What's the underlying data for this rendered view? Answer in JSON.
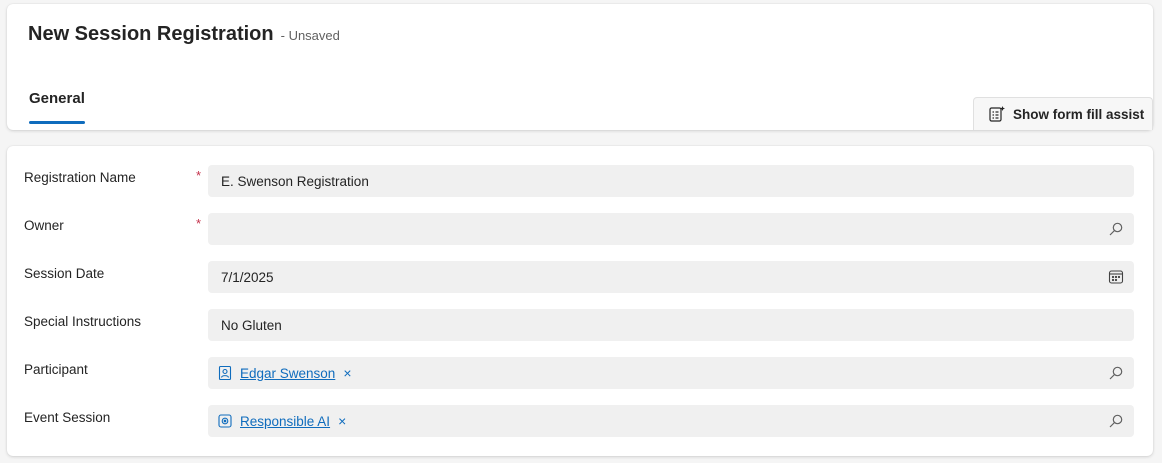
{
  "header": {
    "title": "New Session Registration",
    "status": "- Unsaved",
    "tabs": [
      {
        "label": "General",
        "active": true
      }
    ],
    "assist_button": {
      "label": "Show form fill assist",
      "icon": "form-assist-icon"
    }
  },
  "form": {
    "fields": [
      {
        "label": "Registration Name",
        "required": true,
        "required_mark": "*",
        "value": "E. Swenson Registration"
      },
      {
        "label": "Owner",
        "required": true,
        "required_mark": "*",
        "value": "",
        "icon": "search-icon"
      },
      {
        "label": "Session Date",
        "required": false,
        "value": "7/1/2025",
        "icon": "calendar-icon"
      },
      {
        "label": "Special Instructions",
        "required": false,
        "value": "No Gluten"
      },
      {
        "label": "Participant",
        "required": false,
        "tag": {
          "text": "Edgar Swenson",
          "icon": "contact-icon",
          "remove": "×"
        },
        "icon": "search-icon"
      },
      {
        "label": "Event Session",
        "required": false,
        "tag": {
          "text": "Responsible AI",
          "icon": "session-icon",
          "remove": "×"
        },
        "icon": "search-icon"
      }
    ]
  },
  "colors": {
    "accent": "#0f6cbd",
    "required": "#c4314b",
    "field_bg": "#f0f0f0"
  }
}
